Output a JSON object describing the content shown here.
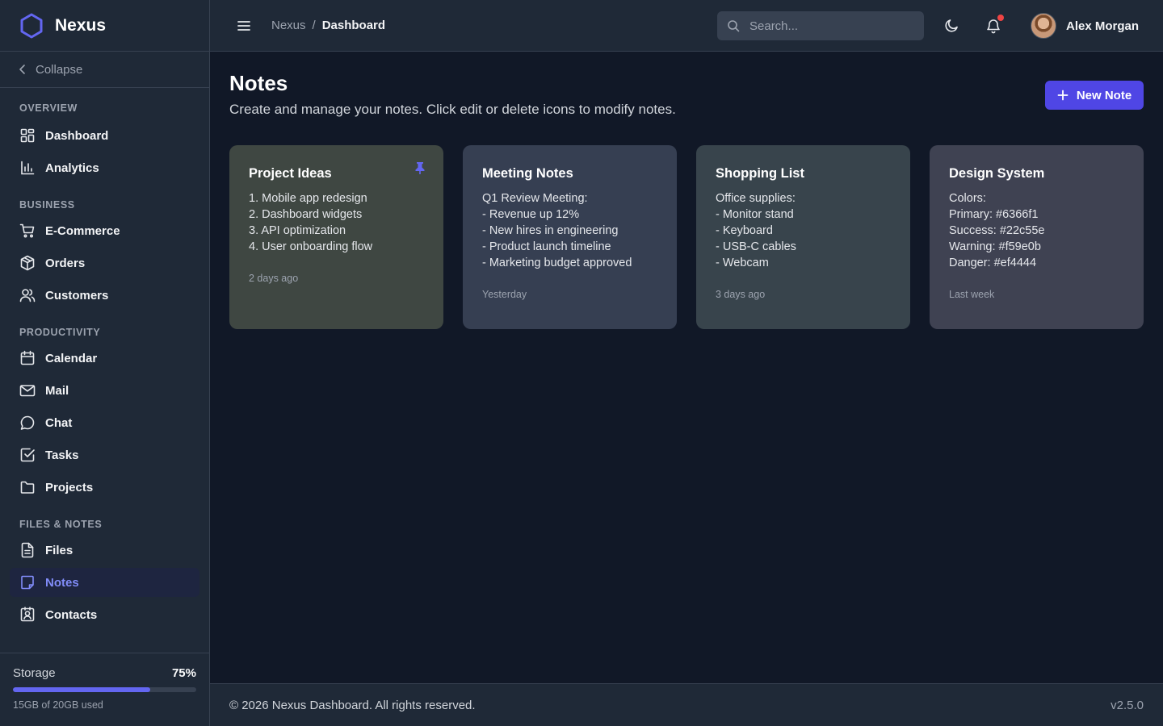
{
  "brand": {
    "name": "Nexus",
    "accent": "#6366f1"
  },
  "sidebar": {
    "collapse_label": "Collapse",
    "sections": [
      {
        "title": "OVERVIEW",
        "items": [
          {
            "label": "Dashboard",
            "icon": "grid-icon"
          },
          {
            "label": "Analytics",
            "icon": "bar-chart-icon"
          }
        ]
      },
      {
        "title": "BUSINESS",
        "items": [
          {
            "label": "E-Commerce",
            "icon": "cart-icon"
          },
          {
            "label": "Orders",
            "icon": "box-icon"
          },
          {
            "label": "Customers",
            "icon": "users-icon"
          }
        ]
      },
      {
        "title": "PRODUCTIVITY",
        "items": [
          {
            "label": "Calendar",
            "icon": "calendar-icon"
          },
          {
            "label": "Mail",
            "icon": "mail-icon"
          },
          {
            "label": "Chat",
            "icon": "chat-icon"
          },
          {
            "label": "Tasks",
            "icon": "check-square-icon"
          },
          {
            "label": "Projects",
            "icon": "folder-icon"
          }
        ]
      },
      {
        "title": "FILES & NOTES",
        "items": [
          {
            "label": "Files",
            "icon": "file-text-icon"
          },
          {
            "label": "Notes",
            "icon": "note-icon",
            "active": true
          },
          {
            "label": "Contacts",
            "icon": "contact-card-icon"
          }
        ]
      }
    ],
    "storage": {
      "label": "Storage",
      "percent_text": "75%",
      "used_fraction": 0.75,
      "detail": "15GB of 20GB used"
    }
  },
  "header": {
    "breadcrumb": [
      "Nexus",
      "Dashboard"
    ],
    "search_placeholder": "Search...",
    "user_name": "Alex Morgan"
  },
  "main": {
    "title": "Notes",
    "subtitle": "Create and manage your notes. Click edit or delete icons to modify notes.",
    "new_note_label": "New Note",
    "notes": [
      {
        "title": "Project Ideas",
        "body": "1. Mobile app redesign\n2. Dashboard widgets\n3. API optimization\n4. User onboarding flow",
        "time": "2 days ago",
        "pinned": true,
        "color": "#3f4742"
      },
      {
        "title": "Meeting Notes",
        "body": "Q1 Review Meeting:\n- Revenue up 12%\n- New hires in engineering\n- Product launch timeline\n- Marketing budget approved",
        "time": "Yesterday",
        "pinned": false,
        "color": "#363f52"
      },
      {
        "title": "Shopping List",
        "body": "Office supplies:\n- Monitor stand\n- Keyboard\n- USB-C cables\n- Webcam",
        "time": "3 days ago",
        "pinned": false,
        "color": "#38444c"
      },
      {
        "title": "Design System",
        "body": "Colors:\nPrimary: #6366f1\nSuccess: #22c55e\nWarning: #f59e0b\nDanger: #ef4444",
        "time": "Last week",
        "pinned": false,
        "color": "#3f4252"
      }
    ]
  },
  "footer": {
    "copyright": "© 2026 Nexus Dashboard. All rights reserved.",
    "version": "v2.5.0"
  }
}
